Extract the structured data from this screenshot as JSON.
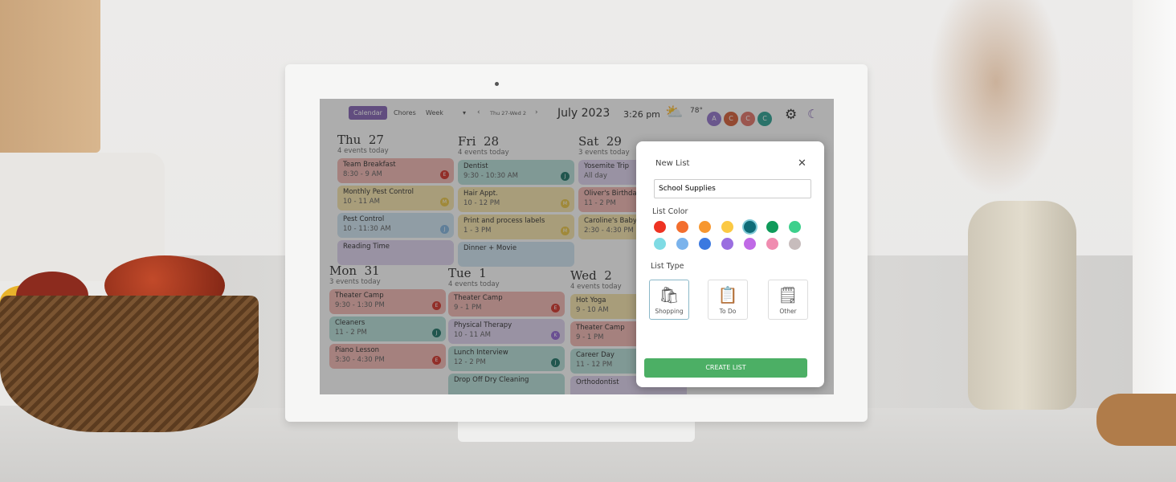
{
  "header": {
    "tabs": [
      {
        "label": "Calendar",
        "active": true
      },
      {
        "label": "Chores",
        "active": false
      }
    ],
    "view_select": "Week",
    "date_range": "Thu 27-Wed 2",
    "month_year": "July 2023",
    "time": "3:26 pm",
    "weather_icon": "partly-sunny-icon",
    "temperature": "78°",
    "profiles": [
      {
        "initial": "A",
        "color": "#8c6bc8"
      },
      {
        "initial": "C",
        "color": "#d2542a"
      },
      {
        "initial": "C",
        "color": "#e06a5e"
      },
      {
        "initial": "C",
        "color": "#1f9c8c"
      }
    ]
  },
  "days": [
    {
      "name": "Thu",
      "num": "27",
      "count": "4 events today",
      "events": [
        {
          "title": "Team Breakfast",
          "time": "8:30 - 9 AM",
          "color": "#f2b4ae",
          "who": "E",
          "who_color": "#d0261c"
        },
        {
          "title": "Monthly Pest Control",
          "time": "10 - 11 AM",
          "color": "#f6e3a8",
          "who": "M",
          "who_color": "#e8c23a"
        },
        {
          "title": "Pest Control",
          "time": "10 - 11:30 AM",
          "color": "#cde3f2",
          "who": "J",
          "who_color": "#7ab0dc"
        },
        {
          "title": "Reading Time",
          "time": "",
          "color": "#dcd0ee",
          "who": "",
          "who_color": ""
        }
      ]
    },
    {
      "name": "Fri",
      "num": "28",
      "count": "4 events today",
      "events": [
        {
          "title": "Dentist",
          "time": "9:30 - 10:30 AM",
          "color": "#b2dcd6",
          "who": "J",
          "who_color": "#0e6a5c"
        },
        {
          "title": "Hair Appt.",
          "time": "10 - 12 PM",
          "color": "#f6e3a8",
          "who": "M",
          "who_color": "#e8c23a"
        },
        {
          "title": "Print and process labels",
          "time": "1 - 3 PM",
          "color": "#f6e3a8",
          "who": "M",
          "who_color": "#e8c23a"
        },
        {
          "title": "Dinner + Movie",
          "time": "",
          "color": "#cde3f2",
          "who": "",
          "who_color": ""
        }
      ]
    },
    {
      "name": "Sat",
      "num": "29",
      "count": "3 events today",
      "events": [
        {
          "title": "Yosemite Trip",
          "time": "All day",
          "color": "#dcd0ee",
          "who": "",
          "who_color": ""
        },
        {
          "title": "Oliver's Birthday",
          "time": "11 - 2 PM",
          "color": "#f2b4ae",
          "who": "",
          "who_color": ""
        },
        {
          "title": "Caroline's Baby Shower",
          "time": "2:30 - 4:30 PM",
          "color": "#f6e3a8",
          "who": "",
          "who_color": ""
        }
      ]
    },
    {
      "name": "Mon",
      "num": "31",
      "count": "3 events today",
      "events": [
        {
          "title": "Theater Camp",
          "time": "9:30 - 1:30 PM",
          "color": "#f2b4ae",
          "who": "E",
          "who_color": "#d0261c"
        },
        {
          "title": "Cleaners",
          "time": "11 - 2 PM",
          "color": "#b2dcd6",
          "who": "J",
          "who_color": "#0e6a5c"
        },
        {
          "title": "Piano Lesson",
          "time": "3:30 - 4:30 PM",
          "color": "#f2b4ae",
          "who": "E",
          "who_color": "#d0261c"
        }
      ]
    },
    {
      "name": "Tue",
      "num": "1",
      "count": "4 events today",
      "events": [
        {
          "title": "Theater Camp",
          "time": "9 - 1 PM",
          "color": "#f2b4ae",
          "who": "E",
          "who_color": "#d0261c"
        },
        {
          "title": "Physical Therapy",
          "time": "10 - 11 AM",
          "color": "#dcd0ee",
          "who": "K",
          "who_color": "#8c5ed0"
        },
        {
          "title": "Lunch Interview",
          "time": "12 - 2 PM",
          "color": "#b2dcd6",
          "who": "J",
          "who_color": "#0e6a5c"
        },
        {
          "title": "Drop Off Dry Cleaning",
          "time": "",
          "color": "#b2dcd6",
          "who": "",
          "who_color": ""
        }
      ]
    },
    {
      "name": "Wed",
      "num": "2",
      "count": "4 events today",
      "events": [
        {
          "title": "Hot Yoga",
          "time": "9 - 10 AM",
          "color": "#f6e3a8",
          "who": "",
          "who_color": ""
        },
        {
          "title": "Theater Camp",
          "time": "9 - 1 PM",
          "color": "#f2b4ae",
          "who": "",
          "who_color": ""
        },
        {
          "title": "Career Day",
          "time": "11 - 12 PM",
          "color": "#b2dcd6",
          "who": "",
          "who_color": ""
        },
        {
          "title": "Orthodontist",
          "time": "",
          "color": "#dcd0ee",
          "who": "",
          "who_color": ""
        }
      ]
    }
  ],
  "dialog": {
    "title": "New List",
    "name_value": "School Supplies",
    "color_label": "List Color",
    "colors": [
      "#ee3322",
      "#f36e2e",
      "#f7972f",
      "#fbc944",
      "#0e6b77",
      "#0f9a5a",
      "#3dd08c",
      "#7fdbe4",
      "#7ab3ec",
      "#3b79e0",
      "#9a6ee0",
      "#c06ae6",
      "#f08cb0",
      "#c7bcbc"
    ],
    "selected_color": "#0e6b77",
    "type_label": "List Type",
    "types": [
      {
        "label": "Shopping",
        "icon": "shopping-bag-icon",
        "selected": true
      },
      {
        "label": "To Do",
        "icon": "clipboard-icon",
        "selected": false
      },
      {
        "label": "Other",
        "icon": "notepad-icon",
        "selected": false
      }
    ],
    "create_label": "CREATE LIST",
    "create_color": "#4caf65"
  }
}
